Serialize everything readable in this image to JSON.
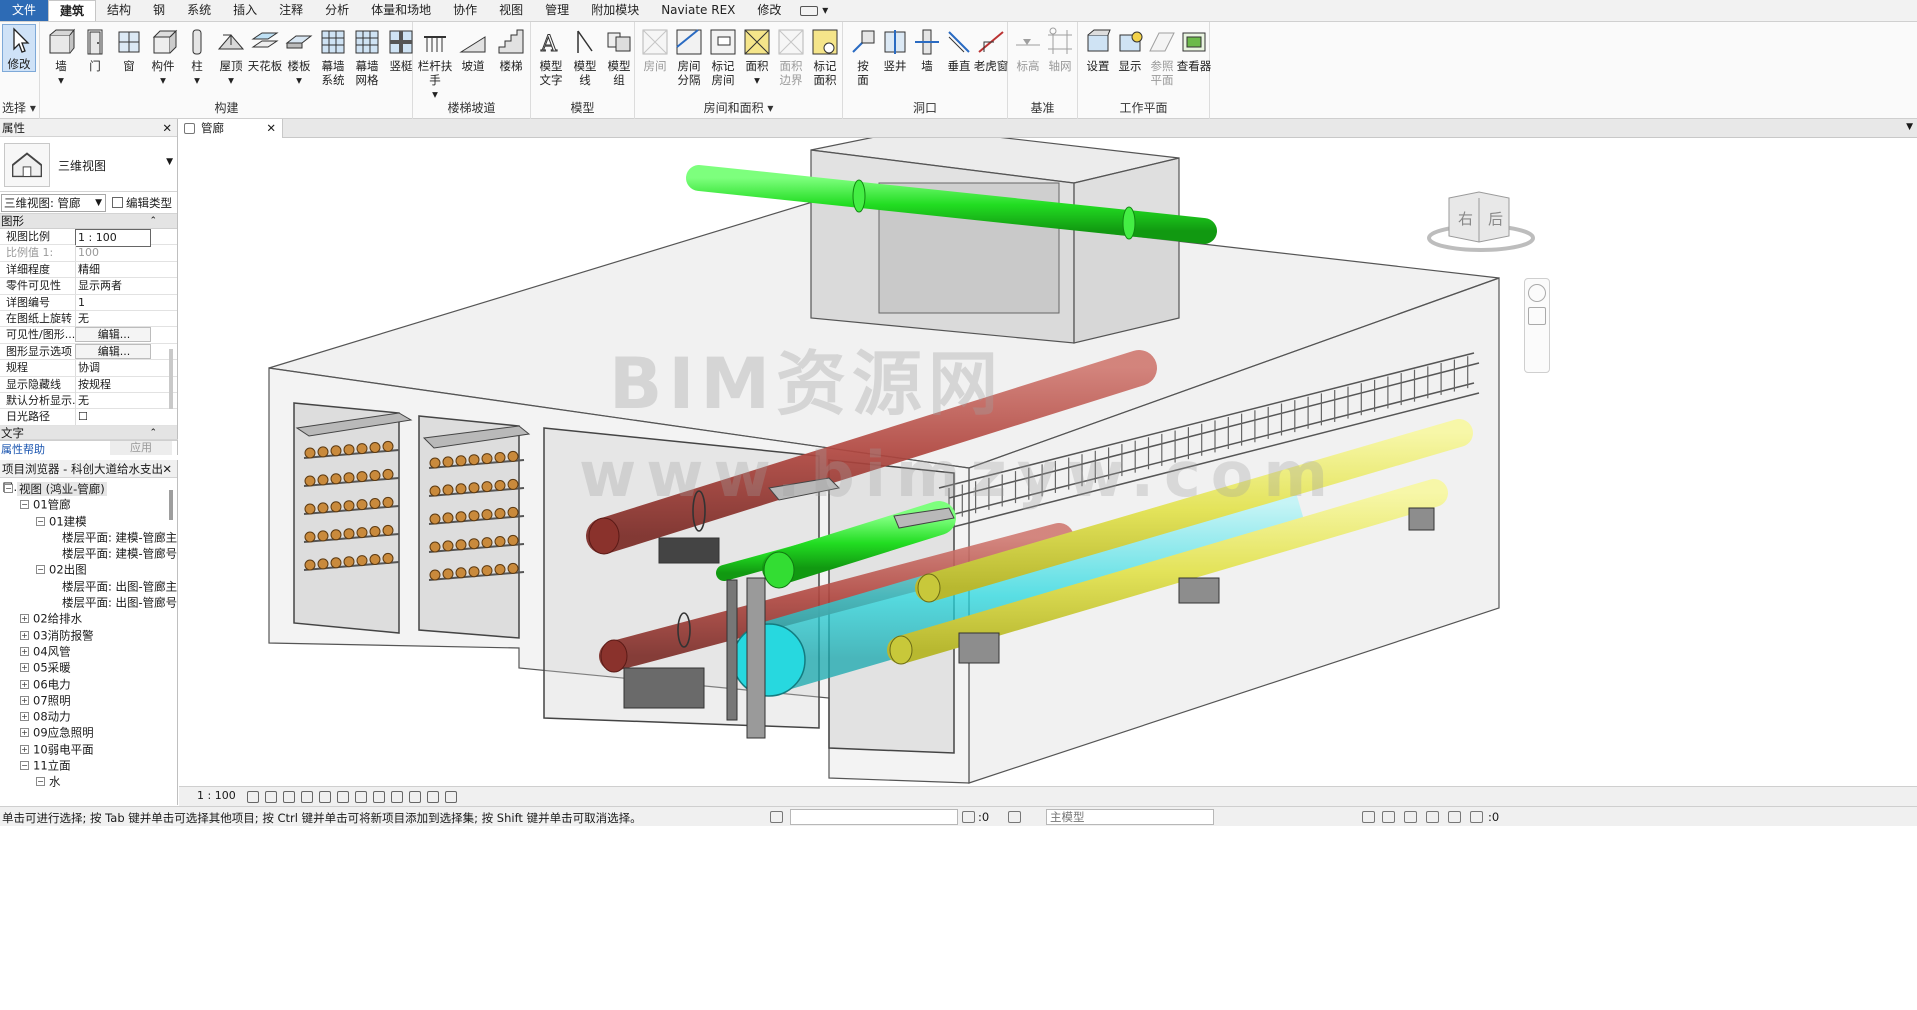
{
  "menu": {
    "tabs": [
      "文件",
      "建筑",
      "结构",
      "钢",
      "系统",
      "插入",
      "注释",
      "分析",
      "体量和场地",
      "协作",
      "视图",
      "管理",
      "附加模块",
      "Naviate REX",
      "修改"
    ],
    "active": "建筑"
  },
  "ribbon": {
    "select": {
      "modify": "修改",
      "select_label": "选择 ▾"
    },
    "build": {
      "label": "构建",
      "buttons": [
        {
          "text": "墙",
          "sub": "▾"
        },
        {
          "text": "门"
        },
        {
          "text": "窗"
        },
        {
          "text": "构件",
          "sub": "▾"
        },
        {
          "text": "柱",
          "sub": "▾"
        },
        {
          "text": "屋顶",
          "sub": "▾"
        },
        {
          "text": "天花板"
        },
        {
          "text": "楼板",
          "sub": "▾"
        },
        {
          "text": "幕墙",
          "sub": "系统"
        },
        {
          "text": "幕墙",
          "sub": "网格"
        },
        {
          "text": "竖梃"
        }
      ]
    },
    "stairs": {
      "label": "楼梯坡道",
      "buttons": [
        {
          "text": "栏杆扶手",
          "sub": "▾"
        },
        {
          "text": "坡道"
        },
        {
          "text": "楼梯"
        }
      ]
    },
    "model": {
      "label": "模型",
      "buttons": [
        {
          "text": "模型",
          "sub": "文字"
        },
        {
          "text": "模型",
          "sub": "线"
        },
        {
          "text": "模型",
          "sub": "组"
        }
      ]
    },
    "room": {
      "label": "房间和面积 ▾",
      "buttons": [
        {
          "text": "房间",
          "disabled": true
        },
        {
          "text": "房间",
          "sub": "分隔"
        },
        {
          "text": "标记",
          "sub": "房间"
        },
        {
          "text": "面积",
          "sub": "▾"
        },
        {
          "text": "面积",
          "sub": "边界",
          "disabled": true
        },
        {
          "text": "标记",
          "sub": "面积"
        }
      ]
    },
    "opening": {
      "label": "洞口",
      "buttons": [
        {
          "text": "按",
          "sub": "面"
        },
        {
          "text": "竖井"
        },
        {
          "text": "墙"
        },
        {
          "text": "垂直"
        },
        {
          "text": "老虎窗"
        }
      ]
    },
    "datum": {
      "label": "基准",
      "buttons": [
        {
          "text": "标高",
          "disabled": true
        },
        {
          "text": "轴网",
          "disabled": true
        }
      ]
    },
    "workplane": {
      "label": "工作平面",
      "buttons": [
        {
          "text": "设置"
        },
        {
          "text": "显示"
        },
        {
          "text": "参照",
          "sub": "平面",
          "disabled": true
        },
        {
          "text": "查看器"
        }
      ]
    }
  },
  "properties": {
    "title": "属性",
    "type_name": "三维视图",
    "view_selector": "三维视图: 管廊",
    "edit_type": "编辑类型",
    "section_graphics": "图形",
    "section_text": "文字",
    "rows": [
      {
        "k": "视图比例",
        "v": "1 : 100",
        "style": "box"
      },
      {
        "k": "比例值 1:",
        "v": "100",
        "style": "gray"
      },
      {
        "k": "详细程度",
        "v": "精细"
      },
      {
        "k": "零件可见性",
        "v": "显示两者"
      },
      {
        "k": "详图编号",
        "v": "1"
      },
      {
        "k": "在图纸上旋转",
        "v": "无"
      },
      {
        "k": "可见性/图形...",
        "v": "编辑...",
        "style": "btn"
      },
      {
        "k": "图形显示选项",
        "v": "编辑...",
        "style": "btn"
      },
      {
        "k": "规程",
        "v": "协调"
      },
      {
        "k": "显示隐藏线",
        "v": "按规程"
      },
      {
        "k": "默认分析显示...",
        "v": "无"
      },
      {
        "k": "日光路径",
        "v": "☐"
      }
    ],
    "help": "属性帮助",
    "apply": "应用"
  },
  "browser": {
    "title": "项目浏览器 - 科创大道给水支出口...",
    "items": [
      {
        "depth": 0,
        "pm": "−",
        "text": "视图 (鸿业-管廊)",
        "sel": true
      },
      {
        "depth": 1,
        "pm": "−",
        "text": "01管廊"
      },
      {
        "depth": 2,
        "pm": "−",
        "text": "01建模"
      },
      {
        "depth": 3,
        "pm": "",
        "text": "楼层平面: 建模-管廊主"
      },
      {
        "depth": 3,
        "pm": "",
        "text": "楼层平面: 建模-管廊号"
      },
      {
        "depth": 2,
        "pm": "−",
        "text": "02出图"
      },
      {
        "depth": 3,
        "pm": "",
        "text": "楼层平面: 出图-管廊主"
      },
      {
        "depth": 3,
        "pm": "",
        "text": "楼层平面: 出图-管廊号"
      },
      {
        "depth": 1,
        "pm": "+",
        "text": "02给排水"
      },
      {
        "depth": 1,
        "pm": "+",
        "text": "03消防报警"
      },
      {
        "depth": 1,
        "pm": "+",
        "text": "04风管"
      },
      {
        "depth": 1,
        "pm": "+",
        "text": "05采暖"
      },
      {
        "depth": 1,
        "pm": "+",
        "text": "06电力"
      },
      {
        "depth": 1,
        "pm": "+",
        "text": "07照明"
      },
      {
        "depth": 1,
        "pm": "+",
        "text": "08动力"
      },
      {
        "depth": 1,
        "pm": "+",
        "text": "09应急照明"
      },
      {
        "depth": 1,
        "pm": "+",
        "text": "10弱电平面"
      },
      {
        "depth": 1,
        "pm": "−",
        "text": "11立面"
      },
      {
        "depth": 2,
        "pm": "−",
        "text": "水"
      }
    ]
  },
  "view": {
    "tab_title": "管廊",
    "watermark_top": "BIM资源网",
    "watermark_bottom": "www.bimzyw.com",
    "viewcube_left": "右",
    "viewcube_right": "后"
  },
  "view_control": {
    "scale": "1 : 100"
  },
  "status": {
    "message": "单击可进行选择; 按 Tab 键并单击可选择其他项目; 按 Ctrl 键并单击可将新项目添加到选择集; 按 Shift 键并单击可取消选择。",
    "coord": ":0",
    "model": "主模型",
    "filter": ":0"
  },
  "colors": {
    "accent": "#2d6bb5",
    "pipe_green": "#22dd22",
    "pipe_red": "#b0463f",
    "pipe_yellow": "#e3e35a",
    "pipe_cyan": "#27d8df",
    "concrete": "#8a8a8a"
  }
}
